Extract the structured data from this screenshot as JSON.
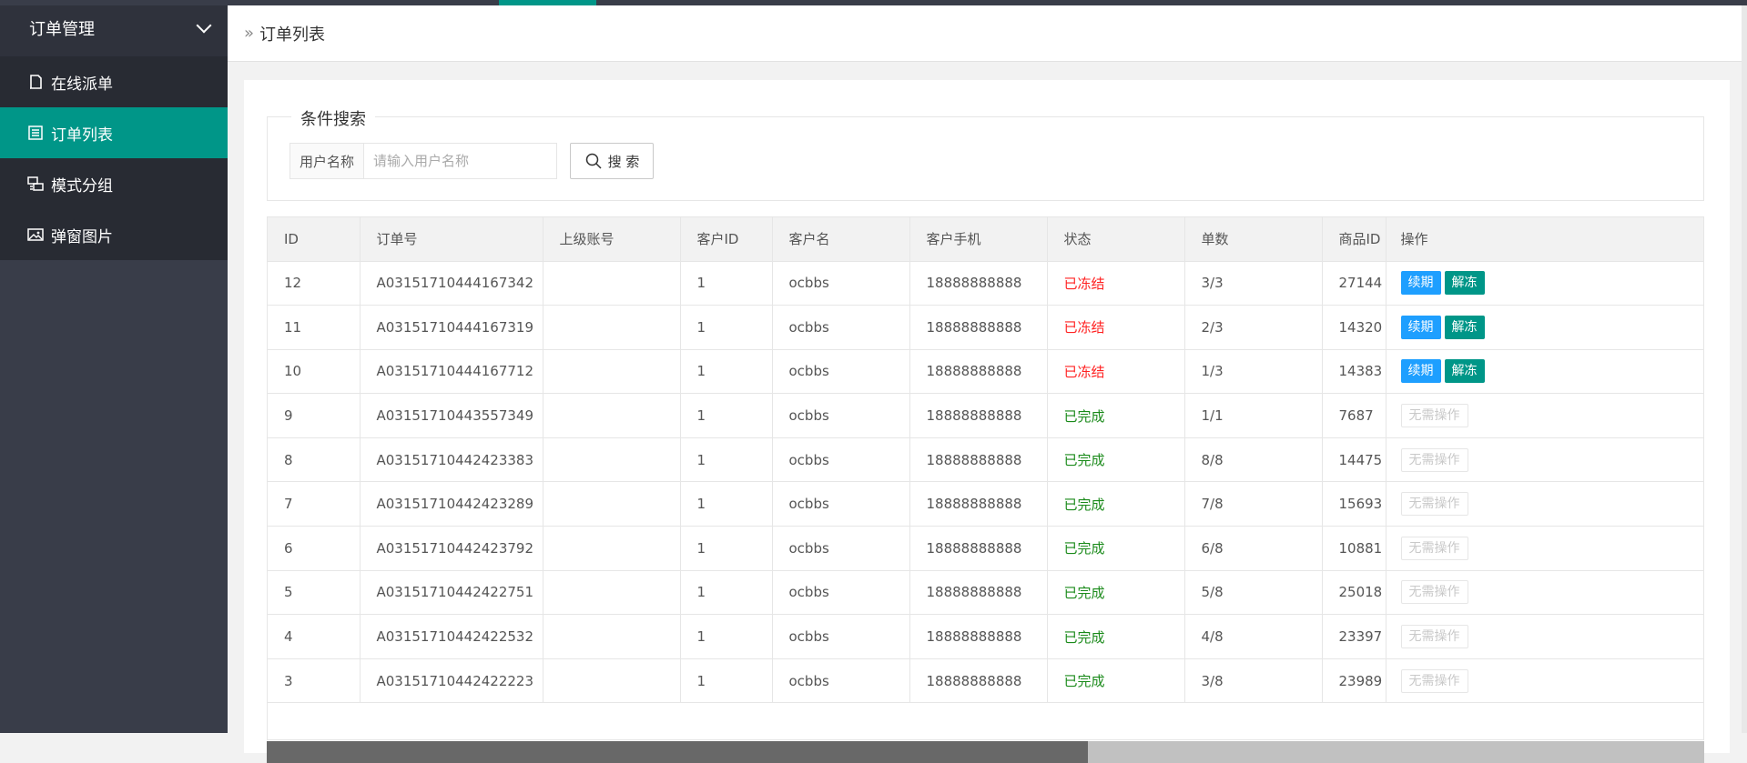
{
  "sidebar": {
    "header": "订单管理",
    "items": [
      {
        "label": "在线派单",
        "icon": "document-icon",
        "active": false
      },
      {
        "label": "订单列表",
        "icon": "list-icon",
        "active": true
      },
      {
        "label": "模式分组",
        "icon": "group-icon",
        "active": false
      },
      {
        "label": "弹窗图片",
        "icon": "image-icon",
        "active": false
      }
    ]
  },
  "breadcrumb": {
    "title": "订单列表"
  },
  "search": {
    "legend": "条件搜索",
    "label": "用户名称",
    "placeholder": "请输入用户名称",
    "button": "搜 索"
  },
  "table": {
    "columns": [
      "ID",
      "订单号",
      "上级账号",
      "客户ID",
      "客户名",
      "客户手机",
      "状态",
      "单数",
      "商品ID",
      "操作"
    ],
    "rows": [
      {
        "id": "12",
        "order": "A03151710444167342",
        "parent": "",
        "cid": "1",
        "cname": "ocbbs",
        "phone": "18888888888",
        "status": "已冻结",
        "count": "3/3",
        "pid": "27144",
        "ops": [
          "续期",
          "解冻"
        ]
      },
      {
        "id": "11",
        "order": "A03151710444167319",
        "parent": "",
        "cid": "1",
        "cname": "ocbbs",
        "phone": "18888888888",
        "status": "已冻结",
        "count": "2/3",
        "pid": "14320",
        "ops": [
          "续期",
          "解冻"
        ]
      },
      {
        "id": "10",
        "order": "A03151710444167712",
        "parent": "",
        "cid": "1",
        "cname": "ocbbs",
        "phone": "18888888888",
        "status": "已冻结",
        "count": "1/3",
        "pid": "14383",
        "ops": [
          "续期",
          "解冻"
        ]
      },
      {
        "id": "9",
        "order": "A03151710443557349",
        "parent": "",
        "cid": "1",
        "cname": "ocbbs",
        "phone": "18888888888",
        "status": "已完成",
        "count": "1/1",
        "pid": "7687",
        "ops": [
          "无需操作"
        ]
      },
      {
        "id": "8",
        "order": "A03151710442423383",
        "parent": "",
        "cid": "1",
        "cname": "ocbbs",
        "phone": "18888888888",
        "status": "已完成",
        "count": "8/8",
        "pid": "14475",
        "ops": [
          "无需操作"
        ]
      },
      {
        "id": "7",
        "order": "A03151710442423289",
        "parent": "",
        "cid": "1",
        "cname": "ocbbs",
        "phone": "18888888888",
        "status": "已完成",
        "count": "7/8",
        "pid": "15693",
        "ops": [
          "无需操作"
        ]
      },
      {
        "id": "6",
        "order": "A03151710442423792",
        "parent": "",
        "cid": "1",
        "cname": "ocbbs",
        "phone": "18888888888",
        "status": "已完成",
        "count": "6/8",
        "pid": "10881",
        "ops": [
          "无需操作"
        ]
      },
      {
        "id": "5",
        "order": "A03151710442422751",
        "parent": "",
        "cid": "1",
        "cname": "ocbbs",
        "phone": "18888888888",
        "status": "已完成",
        "count": "5/8",
        "pid": "25018",
        "ops": [
          "无需操作"
        ]
      },
      {
        "id": "4",
        "order": "A03151710442422532",
        "parent": "",
        "cid": "1",
        "cname": "ocbbs",
        "phone": "18888888888",
        "status": "已完成",
        "count": "4/8",
        "pid": "23397",
        "ops": [
          "无需操作"
        ]
      },
      {
        "id": "3",
        "order": "A03151710442422223",
        "parent": "",
        "cid": "1",
        "cname": "ocbbs",
        "phone": "18888888888",
        "status": "已完成",
        "count": "3/8",
        "pid": "23989",
        "ops": [
          "无需操作"
        ]
      }
    ]
  },
  "colors": {
    "accent": "#009688",
    "sidebar": "#393d49",
    "renew": "#1e9fff",
    "frozen": "#ff2222",
    "done": "#1a8a1a"
  }
}
